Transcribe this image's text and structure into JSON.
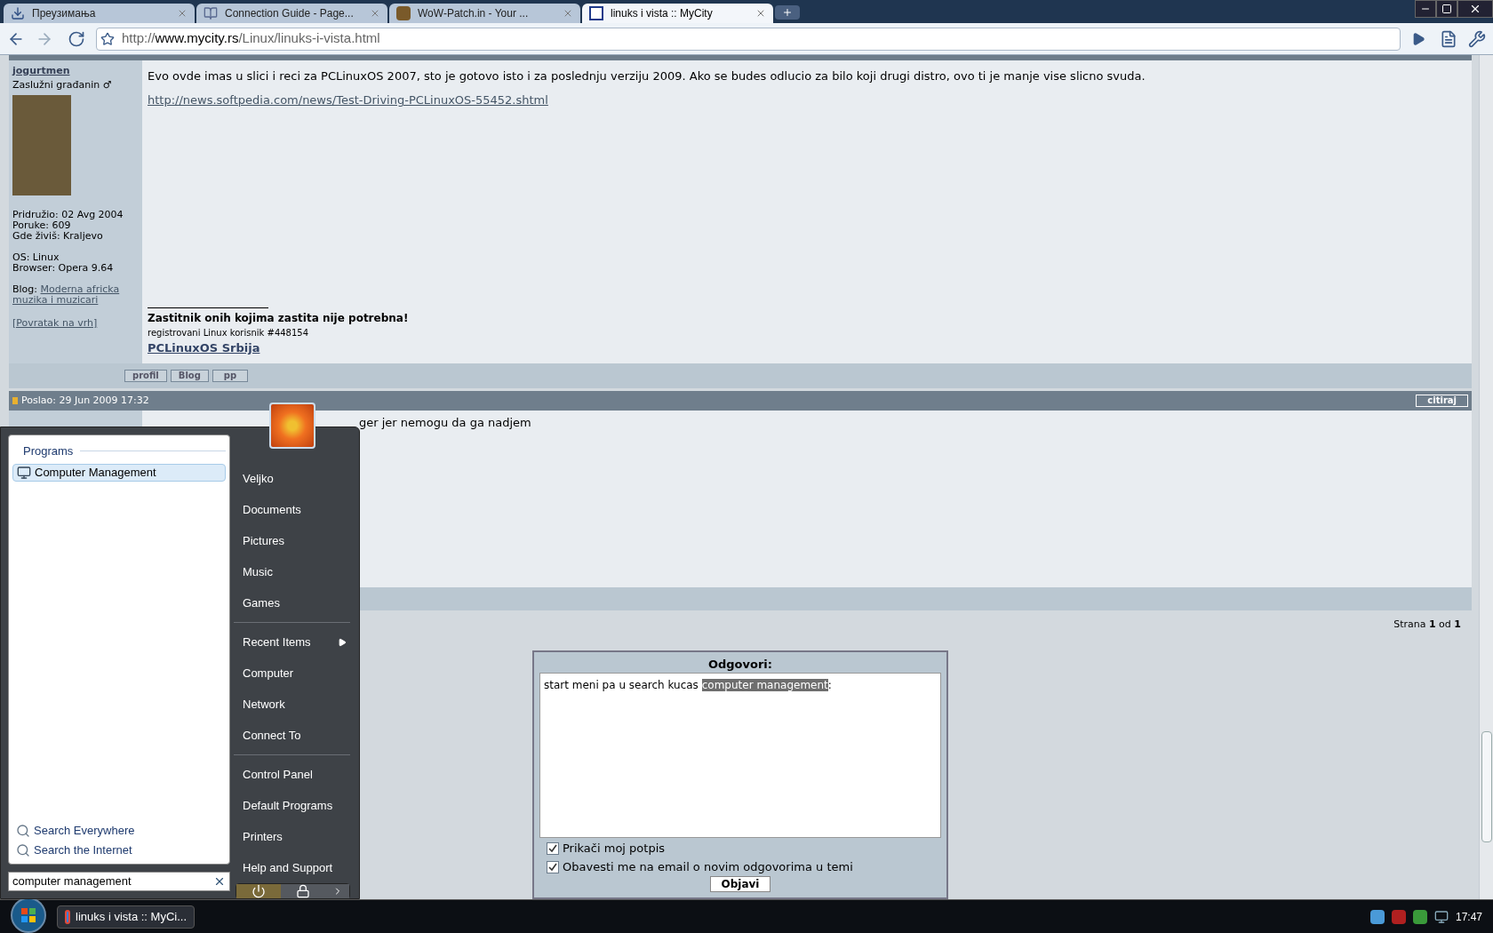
{
  "browser": {
    "tabs": [
      {
        "title": "Преузимања",
        "kind": "download",
        "selected": false
      },
      {
        "title": "Connection Guide - Page...",
        "kind": "guide",
        "selected": false
      },
      {
        "title": "WoW-Patch.in - Your ...",
        "kind": "wow",
        "selected": false
      },
      {
        "title": "linuks i vista :: MyCity",
        "kind": "site",
        "selected": true
      }
    ],
    "url_scheme": "http://",
    "url_host": "www.mycity.rs",
    "url_path": "/Linux/linuks-i-vista.html"
  },
  "post": {
    "author": "jogurtmen",
    "rank": "Zaslužni građanin ♂",
    "info_groups": [
      [
        "Pridružio: 02 Avg 2004",
        "Poruke: 609",
        "Gde živiš: Kraljevo"
      ],
      [
        "OS: Linux",
        "Browser: Opera 9.64"
      ]
    ],
    "blog_label": "Blog:",
    "blog_link": "Moderna africka muzika i muzicari",
    "back_link": "[Povratak na vrh]",
    "text": "Evo ovde imas u slici i reci za PCLinuxOS 2007, sto je gotovo isto i za poslednju verziju 2009. Ako se budes odlucio za bilo koji drugi distro, ovo ti je manje vise slicno svuda.",
    "link": "http://news.softpedia.com/news/Test-Driving-PCLinuxOS-55452.shtml",
    "signature_motto": "Zastitnik onih kojima zastita nije potrebna!",
    "signature_line": "registrovani Linux korisnik #448154",
    "signature_link": "PCLinuxOS Srbija",
    "buttons": [
      "profil",
      "Blog",
      "pp"
    ]
  },
  "post2": {
    "header": "Poslao: 29 Jun 2009 17:32",
    "quote_button": "citiraj",
    "text": "ger jer nemogu da ga nadjem"
  },
  "pagination": "Strana **1** od **1**",
  "reply": {
    "title": "Odgovori:",
    "text_before": "start meni pa u search kucas ",
    "selected_text": "computer management",
    "text_after": ":",
    "options": [
      {
        "label": "Prikači moj potpis",
        "checked": true
      },
      {
        "label": "Obavesti me na email o novim odgovorima u temi",
        "checked": true
      }
    ],
    "submit": "Objavi"
  },
  "start_menu": {
    "results_header": "Programs",
    "results": [
      {
        "label": "Computer Management",
        "selected": true
      }
    ],
    "search_links": [
      "Search Everywhere",
      "Search the Internet"
    ],
    "search_value": "computer management",
    "groups": [
      [
        {
          "label": "Veljko",
          "submenu": false
        },
        {
          "label": "Documents",
          "submenu": false
        },
        {
          "label": "Pictures",
          "submenu": false
        },
        {
          "label": "Music",
          "submenu": false
        },
        {
          "label": "Games",
          "submenu": false
        }
      ],
      [
        {
          "label": "Recent Items",
          "submenu": true
        },
        {
          "label": "Computer",
          "submenu": false
        },
        {
          "label": "Network",
          "submenu": false
        },
        {
          "label": "Connect To",
          "submenu": false
        }
      ],
      [
        {
          "label": "Control Panel",
          "submenu": false
        },
        {
          "label": "Default Programs",
          "submenu": false
        },
        {
          "label": "Printers",
          "submenu": false
        },
        {
          "label": "Help and Support",
          "submenu": false
        }
      ]
    ]
  },
  "taskbar": {
    "window_button": "linuks i vista :: MyCi...",
    "clock": "17:47"
  }
}
